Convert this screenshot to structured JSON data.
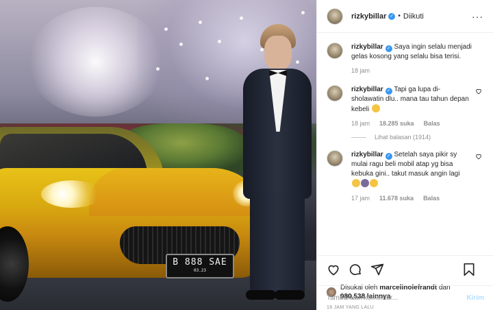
{
  "photo": {
    "plate_number": "B 888 SAE",
    "plate_sub": "03.23"
  },
  "header": {
    "username": "rizkybillar",
    "verified_mark": "✓",
    "separator": "•",
    "follow_status": "Diikuti",
    "more": "···"
  },
  "caption": {
    "username": "rizkybillar",
    "text": "Saya ingin selalu menjadi gelas kosong yang selalu bisa terisi.",
    "time": "18 jam"
  },
  "comments": [
    {
      "username": "rizkybillar",
      "text": "Tapi ga lupa di-sholawatin dlu.. mana tau tahun depan kebeli",
      "time": "18 jam",
      "likes": "18.285 suka",
      "reply": "Balas",
      "view_replies": "Lihat balasan (1914)"
    },
    {
      "username": "rizkybillar",
      "text": "Setelah saya pikir sy mulai ragu beli mobil atap yg bisa kebuka gini.. takut masuk angin lagi",
      "time": "17 jam",
      "likes": "11.678 suka",
      "reply": "Balas"
    }
  ],
  "actions": {
    "liked_prefix": "Disukai oleh",
    "liked_user": "marcelinolefrandt",
    "liked_and": "dan",
    "liked_count": "980,538 lainnya",
    "timestamp": "18 JAM YANG LALU"
  },
  "add_comment": {
    "placeholder": "Tambahkan komentar...",
    "send": "Kirim"
  },
  "colors": {
    "verified": "#3897f0",
    "send_disabled": "#b2dffc",
    "meta_gray": "#8e8e8e"
  }
}
